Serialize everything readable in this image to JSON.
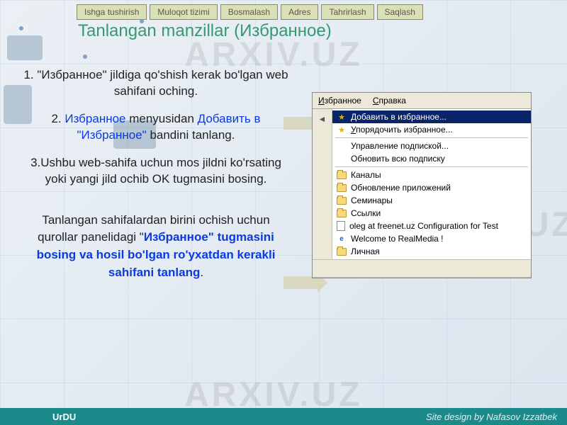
{
  "toolbar": {
    "buttons": [
      "Ishga tushirish",
      "Muloqot tizimi",
      "Bosmalash",
      "Adres",
      "Tahrirlash",
      "Saqlash"
    ]
  },
  "title": "Tanlangan manzillar (Избранное)",
  "steps": {
    "s1_pre": "1. \"Избранное\" jildiga qo'shish kerak bo'lgan web sahifani oching.",
    "s2_pre": "2. ",
    "s2_hl1": "Избранное",
    "s2_mid": " menyusidan ",
    "s2_hl2": "Добавить в \"Избранное\"",
    "s2_post": " bandini tanlang.",
    "s3": "3.Ushbu web-sahifa uchun mos jildni ko'rsating yoki yangi jild ochib OK tugmasini bosing."
  },
  "para": {
    "p1": "Tanlangan sahifalardan birini ochish uchun qurollar panelidagi \"",
    "p_hl": "Избранное\" tugmasini bosing va hosil bo'lgan ro'yxatdan keraklі sahifani tanlang",
    "p_post": "."
  },
  "panel": {
    "menu1": "Избранное",
    "menu2": "Справка",
    "items": [
      {
        "label": "Добавить в избранное...",
        "type": "star",
        "selected": true
      },
      {
        "label": "Упорядочить избранное...",
        "type": "star"
      },
      {
        "sep": true
      },
      {
        "label": "Управление подпиской...",
        "type": "plain"
      },
      {
        "label": "Обновить всю подписку",
        "type": "plain"
      },
      {
        "sep": true
      },
      {
        "label": "Каналы",
        "type": "folder"
      },
      {
        "label": "Обновление приложений",
        "type": "folder"
      },
      {
        "label": "Семинары",
        "type": "folder"
      },
      {
        "label": "Ссылки",
        "type": "folder"
      },
      {
        "label": "oleg at freenet.uz Configuration for Test",
        "type": "page"
      },
      {
        "label": "Welcome to RealMedia !",
        "type": "ie"
      },
      {
        "label": "Личная",
        "type": "folder"
      }
    ]
  },
  "watermark": "ARXIV.UZ",
  "footer": {
    "left": "UrDU",
    "right": "Site design by Nafasov Izzatbek"
  }
}
